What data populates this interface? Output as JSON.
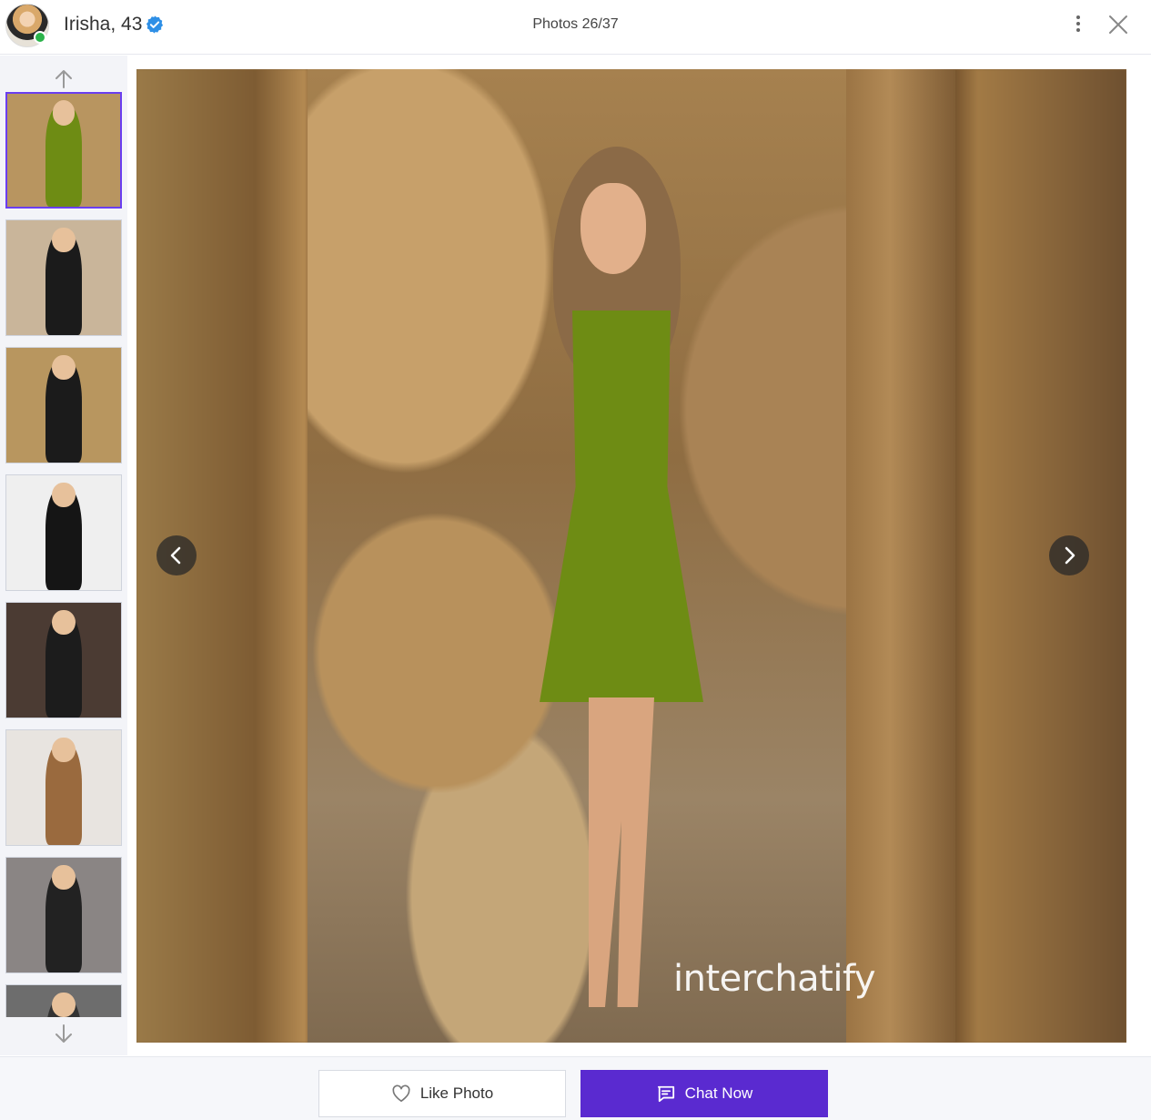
{
  "header": {
    "name": "Irisha, 43",
    "counter": "Photos 26/37",
    "verified_color": "#2e8fe6",
    "online_color": "#2bb34a"
  },
  "thumbnails": [
    {
      "dress": "#6e8c14",
      "bg": "#b89560",
      "active": true
    },
    {
      "dress": "#1b1b1b",
      "bg": "#c9b59a",
      "active": false
    },
    {
      "dress": "#1b1b1b",
      "bg": "#b8965f",
      "active": false
    },
    {
      "dress": "#151515",
      "bg": "#efefef",
      "active": false
    },
    {
      "dress": "#1c1c1c",
      "bg": "#4b3b33",
      "active": false
    },
    {
      "dress": "#9a6a3e",
      "bg": "#e8e4e0",
      "active": false
    },
    {
      "dress": "#222222",
      "bg": "#8a8584",
      "active": false
    },
    {
      "dress": "#333333",
      "bg": "#6d6d6d",
      "active": false
    }
  ],
  "photo": {
    "watermark": "interchatify"
  },
  "actions": {
    "like_label": "Like Photo",
    "chat_label": "Chat Now",
    "chat_color": "#5a2ad0"
  }
}
